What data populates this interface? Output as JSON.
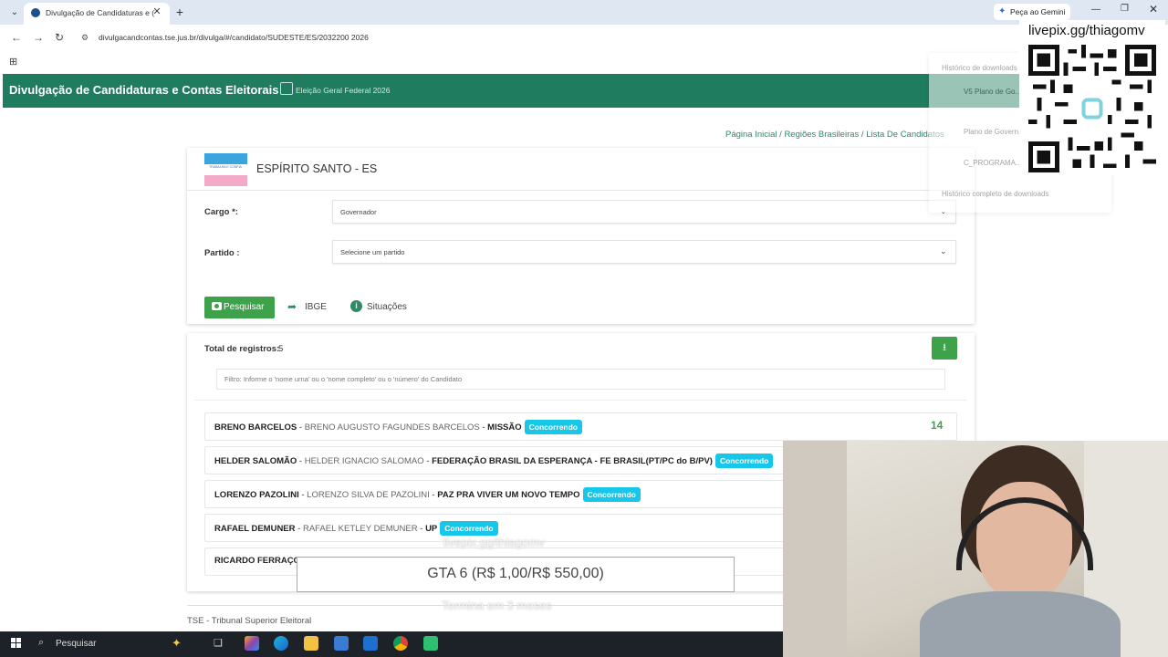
{
  "browser": {
    "tab_title": "Divulgação de Candidaturas e (",
    "url": "divulgacandcontas.tse.jus.br/divulga/#/candidato/SUDESTE/ES/2032200 2026",
    "gemini_button": "Peça ao Gemini"
  },
  "header": {
    "title": "Divulgação de Candidaturas e Contas Eleitorais",
    "election": "Eleição Geral Federal 2026"
  },
  "breadcrumbs": [
    "Página Inicial",
    "Regiões Brasileiras",
    "Lista De Candidatos"
  ],
  "state": {
    "name": "ESPÍRITO SANTO - ES",
    "flag_motto": "TRABALHA E CONFIA"
  },
  "form": {
    "cargo_label": "Cargo *:",
    "cargo_value": "Governador",
    "partido_label": "Partido :",
    "partido_placeholder": "Selecione um partido",
    "search_button": "Pesquisar",
    "ibge_link": "IBGE",
    "situacoes_link": "Situações"
  },
  "results": {
    "total_label": "Total de registros:",
    "total_value": "5",
    "filter_placeholder": "Filtro: Informe o 'nome urna' ou o 'nome completo' ou o 'número' do Candidato",
    "candidates": [
      {
        "urna": "BRENO BARCELOS",
        "full": "BRENO AUGUSTO FAGUNDES BARCELOS",
        "party": "MISSÃO",
        "status": "Concorrendo",
        "number": "14"
      },
      {
        "urna": "HELDER SALOMÃO",
        "full": "HELDER IGNACIO SALOMAO",
        "party": "FEDERAÇÃO BRASIL DA ESPERANÇA - FE BRASIL(PT/PC do B/PV)",
        "status": "Concorrendo",
        "number": ""
      },
      {
        "urna": "LORENZO PAZOLINI",
        "full": "LORENZO SILVA DE PAZOLINI",
        "party": "PAZ PRA VIVER UM NOVO TEMPO",
        "status": "Concorrendo",
        "number": ""
      },
      {
        "urna": "RAFAEL DEMUNER",
        "full": "RAFAEL KETLEY DEMUNER",
        "party": "UP",
        "status": "Concorrendo",
        "number": ""
      },
      {
        "urna": "RICARDO FERRAÇO",
        "full": "",
        "party": "",
        "status": "",
        "number": ""
      }
    ]
  },
  "footer": {
    "text": "TSE - Tribunal Superior Eleitoral"
  },
  "downloads_panel": {
    "title": "Histórico de downloads",
    "items": [
      "V5 Plano de Go... Salomao.pdf",
      "Plano de Govern...",
      "C_PROGRAMA..."
    ],
    "all_link": "Histórico completo de downloads"
  },
  "overlay": {
    "qr_caption": "livepix.gg/thiagomv",
    "goal_ghost": "livepix.gg/thiagomv",
    "goal_text": "GTA 6 (R$ 1,00/R$ 550,00)",
    "goal_sub": "Termina em 3 meses"
  },
  "taskbar": {
    "search_text": "Pesquisar"
  },
  "colors": {
    "header": "#1f7c5e",
    "accent_green": "#3ea24a",
    "badge": "#17c7e9",
    "link": "#31856a"
  }
}
